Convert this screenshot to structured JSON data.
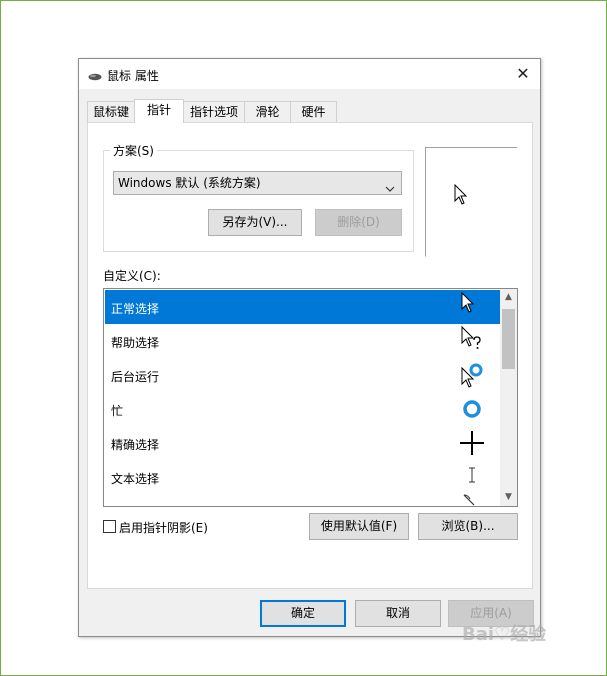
{
  "window": {
    "title": "鼠标 属性",
    "close_glyph": "✕"
  },
  "tabs": [
    {
      "label": "鼠标键",
      "active": false
    },
    {
      "label": "指针",
      "active": true
    },
    {
      "label": "指针选项",
      "active": false
    },
    {
      "label": "滑轮",
      "active": false
    },
    {
      "label": "硬件",
      "active": false
    }
  ],
  "scheme": {
    "group_label": "方案(S)",
    "selected": "Windows 默认 (系统方案)",
    "save_as_label": "另存为(V)...",
    "delete_label": "删除(D)"
  },
  "customize": {
    "label": "自定义(C):",
    "items": [
      {
        "label": "正常选择",
        "icon": "arrow-cursor-icon",
        "selected": true
      },
      {
        "label": "帮助选择",
        "icon": "help-cursor-icon",
        "selected": false
      },
      {
        "label": "后台运行",
        "icon": "working-in-background-cursor-icon",
        "selected": false
      },
      {
        "label": "忙",
        "icon": "busy-cursor-icon",
        "selected": false
      },
      {
        "label": "精确选择",
        "icon": "precision-cursor-icon",
        "selected": false
      },
      {
        "label": "文本选择",
        "icon": "text-cursor-icon",
        "selected": false
      }
    ]
  },
  "shadow_checkbox": {
    "label": "启用指针阴影(E)",
    "checked": false
  },
  "buttons": {
    "use_default": "使用默认值(F)",
    "browse": "浏览(B)...",
    "ok": "确定",
    "cancel": "取消",
    "apply": "应用(A)"
  },
  "watermark": "Bai&#9825;经验",
  "colors": {
    "selection": "#0078d7",
    "frame": "#6fb043",
    "busy_ring": "#1e8fe0"
  }
}
